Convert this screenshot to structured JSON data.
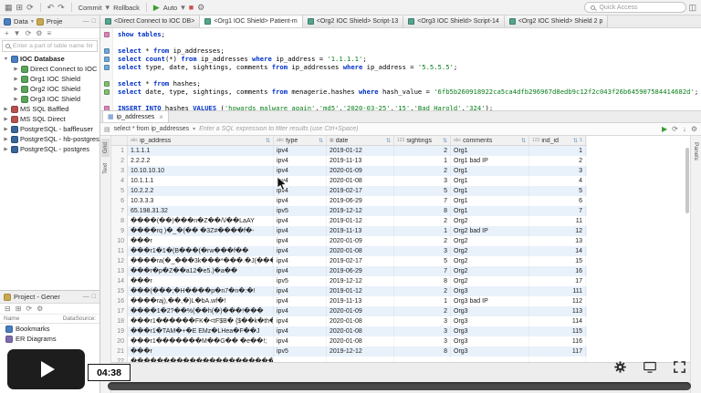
{
  "toolbar": {
    "quick_access": "Quick Access",
    "items": [
      {
        "k": "icon",
        "glyph": "▦",
        "name": "open-project-icon"
      },
      {
        "k": "icon",
        "glyph": "⊞",
        "name": "new-icon"
      },
      {
        "k": "icon",
        "glyph": "⟳",
        "name": "sync-icon"
      },
      {
        "k": "sep"
      },
      {
        "k": "icon",
        "glyph": "↶",
        "name": "undo-icon"
      },
      {
        "k": "icon",
        "glyph": "↷",
        "name": "redo-icon"
      },
      {
        "k": "sep"
      },
      {
        "k": "label",
        "text": "Commit",
        "name": "commit-button"
      },
      {
        "k": "icon",
        "glyph": "▾",
        "name": "commit-dropdown-icon"
      },
      {
        "k": "label",
        "text": "Rollback",
        "name": "rollback-button"
      },
      {
        "k": "sep"
      },
      {
        "k": "icon",
        "glyph": "▶",
        "name": "execute-icon",
        "color": "#3f9c35"
      },
      {
        "k": "label",
        "text": "Auto",
        "name": "auto-commit-select"
      },
      {
        "k": "icon",
        "glyph": "▾",
        "name": "auto-dropdown-icon"
      },
      {
        "k": "icon",
        "glyph": "■",
        "name": "stop-icon",
        "color": "#c75450"
      },
      {
        "k": "icon",
        "glyph": "⚙",
        "name": "settings-icon"
      }
    ]
  },
  "glyphs": {
    "caret_down": "▾",
    "minimize": "—",
    "restore": "□",
    "close": "×",
    "table": "▦",
    "statement": "▤"
  },
  "editor_tabs": [
    {
      "label": "<Direct Connect to IOC DB>",
      "active": false
    },
    {
      "label": "<Org1 IOC Shield> Patient-m",
      "active": true
    },
    {
      "label": "<Org2 IOC Shield> Script-13",
      "active": false
    },
    {
      "label": "<Org3 IOC Shield> Script-14",
      "active": false
    },
    {
      "label": "<Org2 IOC Shield> Shield 2 p",
      "active": false
    }
  ],
  "database_panel": {
    "tab_database": "Data",
    "tab_project": "Proje",
    "toolbar_icons": [
      {
        "name": "add-icon",
        "glyph": "+"
      },
      {
        "name": "filter-icon",
        "glyph": "▼"
      },
      {
        "name": "sync-icon",
        "glyph": "⟳"
      },
      {
        "name": "settings-icon",
        "glyph": "⚙"
      },
      {
        "name": "more-icon",
        "glyph": "≡"
      }
    ],
    "search_placeholder": "Enter a part of table name hir",
    "tree": [
      {
        "label": "IOC Database",
        "level": 0,
        "arrow": "▼",
        "bold": true,
        "icon": "db-blue"
      },
      {
        "label": "Direct Connect to IOC D",
        "level": 1,
        "arrow": "▶",
        "icon": "console-green"
      },
      {
        "label": "Org1 IOC Shield",
        "level": 1,
        "arrow": "▶",
        "icon": "console-green"
      },
      {
        "label": "Org2 IOC Shield",
        "level": 1,
        "arrow": "▶",
        "icon": "console-green"
      },
      {
        "label": "Org3 IOC Shield",
        "level": 1,
        "arrow": "▶",
        "icon": "console-green"
      },
      {
        "label": "MS SQL Baffled",
        "level": 0,
        "arrow": "▶",
        "icon": "db-red"
      },
      {
        "label": "MS SQL Direct",
        "level": 0,
        "arrow": "▶",
        "icon": "db-red"
      },
      {
        "label": "PostgreSQL - baffleuser",
        "level": 0,
        "arrow": "▶",
        "icon": "db-blue2"
      },
      {
        "label": "PostgreSQL - hb-postgres",
        "level": 0,
        "arrow": "▶",
        "icon": "db-blue2"
      },
      {
        "label": "PostgreSQL - postgres",
        "level": 0,
        "arrow": "▶",
        "icon": "db-blue2"
      }
    ]
  },
  "project_panel": {
    "title": "Project - Gener",
    "toolbar_icons": [
      {
        "name": "collapse-icon",
        "glyph": "⊟"
      },
      {
        "name": "expand-icon",
        "glyph": "⊞"
      },
      {
        "name": "sync-icon",
        "glyph": "⟳"
      },
      {
        "name": "settings-icon",
        "glyph": "⚙"
      }
    ],
    "col_name": "Name",
    "col_datasource": "DataSource:",
    "items": [
      {
        "label": "Bookmarks",
        "icon": "bookmark"
      },
      {
        "label": "ER Diagrams",
        "icon": "diagram"
      }
    ]
  },
  "editor": {
    "lines": [
      {
        "gutter": "pink",
        "segs": [
          {
            "t": "kw",
            "s": "show tables"
          },
          {
            "t": "p",
            "s": ";"
          }
        ]
      },
      {
        "segs": []
      },
      {
        "gutter": "blue",
        "segs": [
          {
            "t": "kw",
            "s": "select"
          },
          {
            "t": "p",
            "s": " * "
          },
          {
            "t": "kw",
            "s": "from"
          },
          {
            "t": "p",
            "s": " ip_addresses;"
          }
        ]
      },
      {
        "gutter": "blue",
        "segs": [
          {
            "t": "kw",
            "s": "select count"
          },
          {
            "t": "p",
            "s": "(*) "
          },
          {
            "t": "kw",
            "s": "from"
          },
          {
            "t": "p",
            "s": " ip_addresses "
          },
          {
            "t": "kw",
            "s": "where"
          },
          {
            "t": "p",
            "s": " ip_address = "
          },
          {
            "t": "str",
            "s": "'1.1.1.1'"
          },
          {
            "t": "p",
            "s": ";"
          }
        ]
      },
      {
        "gutter": "blue",
        "segs": [
          {
            "t": "kw",
            "s": "select"
          },
          {
            "t": "p",
            "s": " type, date, sightings, comments "
          },
          {
            "t": "kw",
            "s": "from"
          },
          {
            "t": "p",
            "s": " ip_addresses "
          },
          {
            "t": "kw",
            "s": "where"
          },
          {
            "t": "p",
            "s": " ip_address = "
          },
          {
            "t": "str",
            "s": "'5.5.5.5'"
          },
          {
            "t": "p",
            "s": ";"
          }
        ]
      },
      {
        "segs": []
      },
      {
        "gutter": "green",
        "segs": [
          {
            "t": "kw",
            "s": "select"
          },
          {
            "t": "p",
            "s": " * "
          },
          {
            "t": "kw",
            "s": "from"
          },
          {
            "t": "p",
            "s": " hashes;"
          }
        ]
      },
      {
        "gutter": "green",
        "segs": [
          {
            "t": "kw",
            "s": "select"
          },
          {
            "t": "p",
            "s": " date, type, sightings, comments "
          },
          {
            "t": "kw",
            "s": "from"
          },
          {
            "t": "p",
            "s": " menagerie.hashes "
          },
          {
            "t": "kw",
            "s": "where"
          },
          {
            "t": "p",
            "s": " hash_value = "
          },
          {
            "t": "str",
            "s": "'6fb5b260918922ca5ca4dfb296967d8edb9c12f2c043f26b645907584414682d'"
          },
          {
            "t": "p",
            "s": ";"
          }
        ]
      },
      {
        "segs": []
      },
      {
        "gutter": "pink",
        "segs": [
          {
            "t": "kw",
            "s": "INSERT INTO"
          },
          {
            "t": "p",
            "s": " hashes "
          },
          {
            "t": "kw",
            "s": "VALUES"
          },
          {
            "t": "p",
            "s": " ("
          },
          {
            "t": "str",
            "s": "'howards malware again'"
          },
          {
            "t": "p",
            "s": ","
          },
          {
            "t": "str",
            "s": "'md5'"
          },
          {
            "t": "p",
            "s": ","
          },
          {
            "t": "str",
            "s": "'2020-03-25'"
          },
          {
            "t": "p",
            "s": ","
          },
          {
            "t": "str",
            "s": "'15'"
          },
          {
            "t": "p",
            "s": ","
          },
          {
            "t": "str",
            "s": "'Bad Harold'"
          },
          {
            "t": "p",
            "s": ","
          },
          {
            "t": "str",
            "s": "'324'"
          },
          {
            "t": "p",
            "s": ");"
          }
        ]
      }
    ]
  },
  "results": {
    "tab_label": "ip_addresses",
    "statement": "select * from ip_addresses",
    "filter_placeholder": "Enter a SQL expression to filter results (use Ctrl+Space)",
    "toolbar_icons": [
      {
        "name": "rerun-icon",
        "glyph": "▶",
        "color": "#3f9c35"
      },
      {
        "name": "refresh-icon",
        "glyph": "⟳"
      },
      {
        "name": "load-more-icon",
        "glyph": "↓"
      },
      {
        "name": "results-settings-icon",
        "glyph": "⚙"
      }
    ],
    "side_tabs": [
      "Grid",
      "Text"
    ],
    "side_tab_right": "Panels",
    "columns": [
      {
        "name": "ip_address",
        "type_glyph": "abc",
        "align": "left"
      },
      {
        "name": "type",
        "type_glyph": "abc",
        "align": "left"
      },
      {
        "name": "date",
        "type_glyph": "▦",
        "align": "left"
      },
      {
        "name": "sightings",
        "type_glyph": "123",
        "align": "right"
      },
      {
        "name": "comments",
        "type_glyph": "abc",
        "align": "left"
      },
      {
        "name": "ind_id",
        "type_glyph": "123",
        "align": "right",
        "sort": "1"
      }
    ],
    "rows": [
      [
        "1.1.1.1",
        "ipv4",
        "2019-01-12",
        "2",
        "Org1",
        "1"
      ],
      [
        "2.2.2.2",
        "ipv4",
        "2019-11-13",
        "1",
        "Org1 bad IP",
        "2"
      ],
      [
        "10.10.10.10",
        "ipv4",
        "2020-01-09",
        "2",
        "Org1",
        "3"
      ],
      [
        "10.1.1.1",
        "ipv4",
        "2020-01-08",
        "3",
        "Org1",
        "4"
      ],
      [
        "10.2.2.2",
        "ipv4",
        "2019-02-17",
        "5",
        "Org1",
        "5"
      ],
      [
        "10.3.3.3",
        "ipv4",
        "2019-06-29",
        "7",
        "Org1",
        "6"
      ],
      [
        "65.198.31.32",
        "ipv5",
        "2019-12-12",
        "8",
        "Org1",
        "7"
      ],
      [
        "����(��)���n�Z��/\\/��LaAY",
        "ipv4",
        "2019-01-12",
        "2",
        "Org2",
        "11"
      ],
      [
        "����rq )�_�(�� �3Z#����f�-",
        "ipv4",
        "2019-11-13",
        "1",
        "Org2 bad IP",
        "12"
      ],
      [
        "���r",
        "ipv4",
        "2020-01-09",
        "2",
        "Org2",
        "13"
      ],
      [
        "���r1�1�(B���(�rw���f��",
        "ipv4",
        "2020-01-08",
        "3",
        "Org2",
        "14"
      ],
      [
        "����ra(�_���3k���*���.�J(����",
        "ipv4",
        "2019-02-17",
        "5",
        "Org2",
        "15"
      ],
      [
        "���r�p�Z��a12�e5.)�a��",
        "ipv4",
        "2019-06-29",
        "7",
        "Org2",
        "16"
      ],
      [
        "���r",
        "ipv5",
        "2019-12-12",
        "8",
        "Org2",
        "17"
      ],
      [
        "���(���;�H����p�n7�n�:�!",
        "ipv4",
        "2019-01-12",
        "2",
        "Org3",
        "111"
      ],
      [
        "����raj),��,�)L�bA.wf�!",
        "ipv4",
        "2019-11-13",
        "1",
        "Org3 bad IP",
        "112"
      ],
      [
        "����1�2?��%(��h(�)���!���",
        "ipv4",
        "2020-01-09",
        "2",
        "Org3",
        "113"
      ],
      [
        "���r1������FK�<tF$B� {$��k�th�",
        "ipv4",
        "2020-01-08",
        "3",
        "Org3",
        "114"
      ],
      [
        "���r1�TAM�+�E EMz�LHea�F��J",
        "ipv4",
        "2020-01-08",
        "3",
        "Org3",
        "115"
      ],
      [
        "���r1�������M��G�� �e��!;",
        "ipv4",
        "2020-01-08",
        "3",
        "Org3",
        "116"
      ],
      [
        "���r",
        "ipv5",
        "2019-12-12",
        "8",
        "Org3",
        "117"
      ],
      [
        "��������������������������������",
        "",
        "",
        "",
        "",
        ""
      ]
    ]
  },
  "video": {
    "time": "04:38"
  }
}
